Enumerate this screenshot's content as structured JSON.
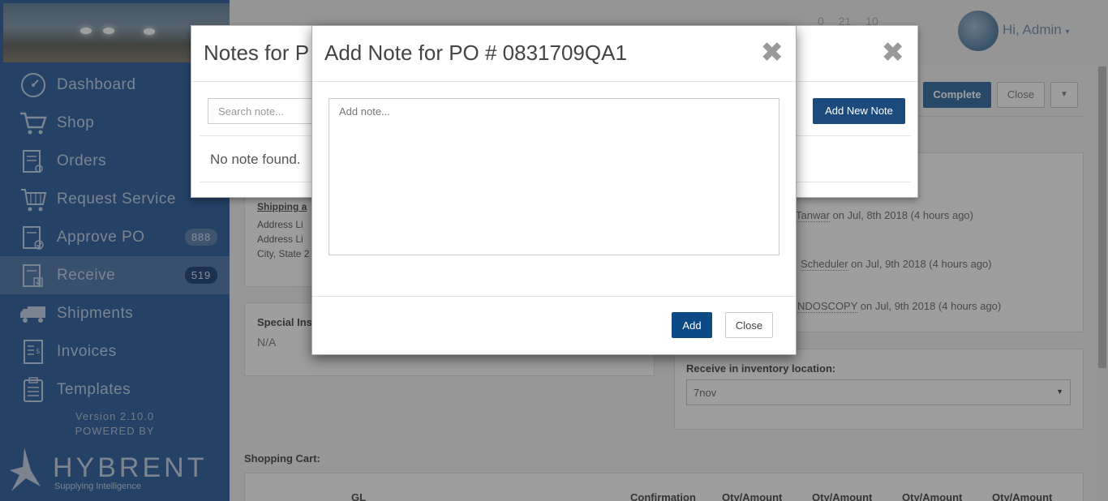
{
  "sidebar": {
    "items": [
      {
        "label": "Dashboard",
        "icon": "dashboard-icon"
      },
      {
        "label": "Shop",
        "icon": "cart-icon"
      },
      {
        "label": "Orders",
        "icon": "orders-icon"
      },
      {
        "label": "Request Service",
        "icon": "service-cart-icon"
      },
      {
        "label": "Approve PO",
        "icon": "approve-icon",
        "badge": "888"
      },
      {
        "label": "Receive",
        "icon": "receive-icon",
        "badge": "519",
        "active": true
      },
      {
        "label": "Shipments",
        "icon": "truck-icon"
      },
      {
        "label": "Invoices",
        "icon": "invoice-icon"
      },
      {
        "label": "Templates",
        "icon": "templates-icon"
      }
    ],
    "version": "Version 2.10.0",
    "powered_by": "POWERED BY",
    "logo_word": "HYBRENT",
    "logo_tagline": "Supplying Intelligence"
  },
  "header": {
    "stats": [
      "0",
      "21",
      "10"
    ],
    "greeting": "Hi, Admin"
  },
  "toolbar": {
    "complete_label": "Complete",
    "close_label": "Close"
  },
  "order": {
    "shipping_title": "Shipping a",
    "address_lines": [
      "Address Li",
      "Address Li",
      "City, State 2"
    ],
    "special_title": "Special Ins",
    "special_value": "N/A",
    "history": [
      {
        "name": "Tanwar",
        "when": " on Jul, 8th 2018 (4 hours ago)"
      },
      {
        "name": "Scheduler",
        "when": " on Jul, 9th 2018 (4 hours ago)"
      },
      {
        "name": "NDOSCOPY",
        "when": " on Jul, 9th 2018 (4 hours ago)"
      }
    ],
    "receive_label": "Receive in inventory location:",
    "receive_value": "7nov",
    "cart_label": "Shopping Cart:",
    "cart_headers": [
      "GL",
      "Confirmation",
      "Qty/Amount",
      "Qty/Amount",
      "Qty/Amount",
      "Qty/Amount"
    ]
  },
  "notes_modal": {
    "title": "Notes for P",
    "search_placeholder": "Search note...",
    "add_new_label": "Add New Note",
    "empty_text": "No note found.",
    "close_glyph": "✖"
  },
  "add_note_modal": {
    "title": "Add Note for PO # 0831709QA1",
    "textarea_placeholder": "Add note...",
    "add_label": "Add",
    "close_label": "Close",
    "close_glyph": "✖"
  },
  "colors": {
    "sidebar": "#3d6aa3",
    "primary_button": "#0b4a84",
    "accent": "#3f77a6"
  }
}
